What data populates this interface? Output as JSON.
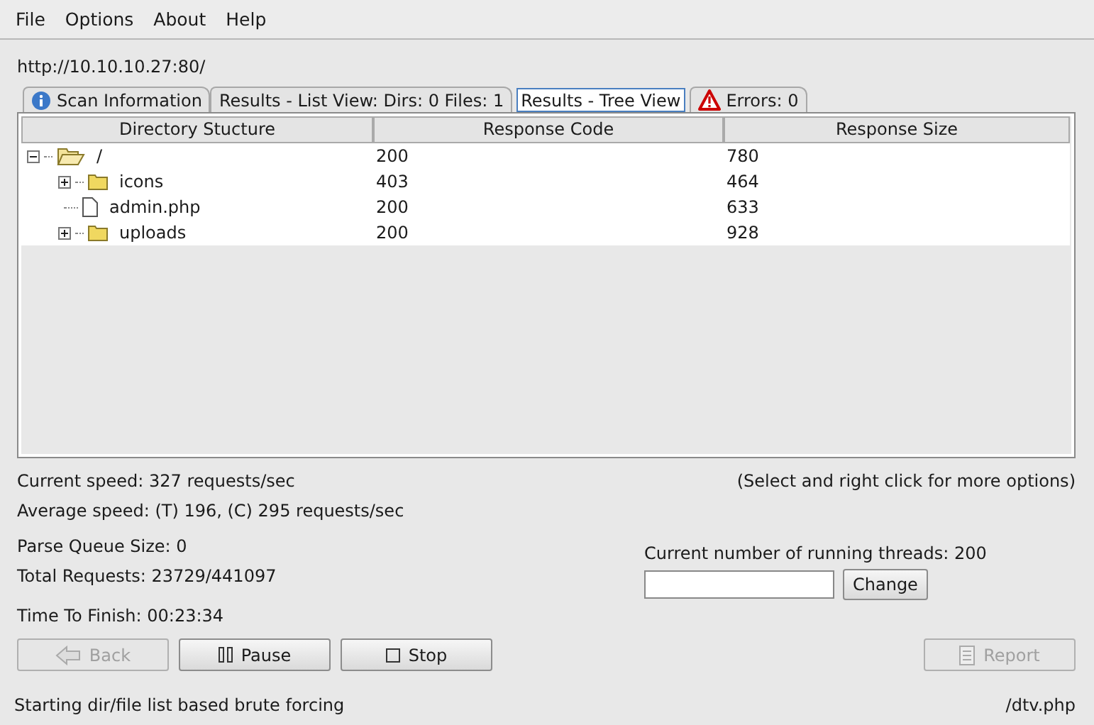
{
  "menu": [
    "File",
    "Options",
    "About",
    "Help"
  ],
  "url": "http://10.10.10.27:80/",
  "tabs": [
    {
      "label": "Scan Information",
      "kind": "info",
      "selected": false
    },
    {
      "label": "Results - List View: Dirs: 0 Files: 1",
      "selected": false
    },
    {
      "label": "Results - Tree View",
      "selected": true
    },
    {
      "label": "Errors: 0",
      "kind": "warning",
      "selected": false
    }
  ],
  "table": {
    "columns": [
      "Directory Stucture",
      "Response Code",
      "Response Size"
    ],
    "rows": [
      {
        "kind": "folder",
        "name": "/",
        "code": "200",
        "size": "780",
        "expanded": true,
        "children": [
          {
            "kind": "folder",
            "name": "icons",
            "code": "403",
            "size": "464",
            "expanded": false
          },
          {
            "kind": "file",
            "name": "admin.php",
            "code": "200",
            "size": "633"
          },
          {
            "kind": "folder",
            "name": "uploads",
            "code": "200",
            "size": "928",
            "expanded": false
          }
        ]
      }
    ]
  },
  "hint": "(Select and right click for more options)",
  "stats": {
    "current_speed": "Current speed: 327 requests/sec",
    "average_speed": "Average speed: (T) 196, (C) 295 requests/sec",
    "parse_queue": "Parse Queue Size: 0",
    "total_requests": "Total Requests: 23729/441097",
    "time_to_finish": "Time To Finish: 00:23:34"
  },
  "threads": {
    "label": "Current number of running threads: 200",
    "button": "Change"
  },
  "buttons": [
    {
      "label": "Back",
      "kind": "back",
      "disabled": true
    },
    {
      "label": "Pause",
      "kind": "pause",
      "disabled": false
    },
    {
      "label": "Stop",
      "kind": "stop",
      "disabled": false
    }
  ],
  "report": {
    "label": "Report",
    "disabled": true
  },
  "status_bar": {
    "message": "Starting dir/file list based brute forcing",
    "current": "/dtv.php"
  }
}
